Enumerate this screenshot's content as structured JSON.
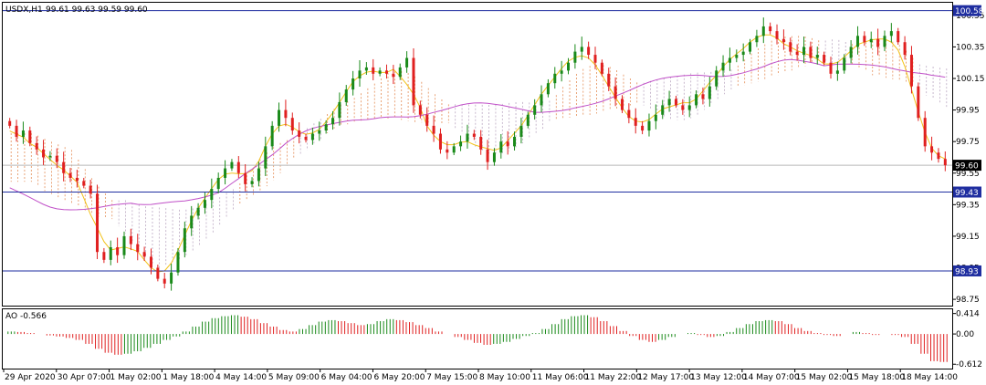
{
  "header": {
    "symbol": "USDX,H1",
    "ohlc": "99.61 99.63 99.59 99.60"
  },
  "indicator": {
    "label": "AO -0.566",
    "ticks": [
      "0.414",
      "0.00",
      "-0.612"
    ],
    "range": [
      -0.7,
      0.5
    ]
  },
  "colors": {
    "bull": "#1a8a1a",
    "bear": "#e02020",
    "level_line": "#1f2ea0",
    "level_badge": "#1f2ea0",
    "current_badge": "#000000",
    "ma_fast": "#f2c21a",
    "ma_slow": "#c050c8",
    "cloud_a": "#e07a3a",
    "cloud_b": "#b09ab8",
    "grid_frame": "#000000"
  },
  "chart_data": {
    "type": "candlestick",
    "title": "USDX,H1",
    "y_ticks": [
      "100.55",
      "100.35",
      "100.15",
      "99.95",
      "99.75",
      "99.55",
      "99.35",
      "99.15",
      "98.95",
      "98.75"
    ],
    "x_ticks": [
      "29 Apr 2020",
      "30 Apr 07:00",
      "1 May 02:00",
      "1 May 18:00",
      "4 May 14:00",
      "5 May 09:00",
      "6 May 04:00",
      "6 May 20:00",
      "7 May 15:00",
      "8 May 10:00",
      "11 May 06:00",
      "11 May 22:00",
      "12 May 17:00",
      "13 May 12:00",
      "14 May 07:00",
      "15 May 02:00",
      "15 May 18:00",
      "18 May 14:00"
    ],
    "ylim": [
      98.71,
      100.63
    ],
    "levels": [
      {
        "label": "100.58",
        "value": 100.58
      },
      {
        "label": "99.43",
        "value": 99.43
      },
      {
        "label": "98.93",
        "value": 98.93
      }
    ],
    "current": {
      "label": "99.60",
      "value": 99.6
    },
    "series_close": [
      99.85,
      99.78,
      99.82,
      99.74,
      99.7,
      99.65,
      99.66,
      99.62,
      99.55,
      99.52,
      99.5,
      99.47,
      99.42,
      99.05,
      99.0,
      99.08,
      99.03,
      99.15,
      99.1,
      99.05,
      99.02,
      98.95,
      98.88,
      98.85,
      98.92,
      99.05,
      99.2,
      99.28,
      99.33,
      99.38,
      99.45,
      99.52,
      99.58,
      99.62,
      99.55,
      99.48,
      99.5,
      99.58,
      99.72,
      99.85,
      99.95,
      99.9,
      99.82,
      99.78,
      99.76,
      99.8,
      99.82,
      99.86,
      99.9,
      100.0,
      100.08,
      100.15,
      100.2,
      100.22,
      100.18,
      100.2,
      100.18,
      100.16,
      100.22,
      100.28,
      99.98,
      99.92,
      99.85,
      99.8,
      99.7,
      99.68,
      99.72,
      99.75,
      99.8,
      99.78,
      99.7,
      99.62,
      99.68,
      99.75,
      99.72,
      99.78,
      99.85,
      99.92,
      99.98,
      100.05,
      100.12,
      100.18,
      100.2,
      100.25,
      100.32,
      100.35,
      100.3,
      100.25,
      100.18,
      100.1,
      100.02,
      99.95,
      99.9,
      99.85,
      99.82,
      99.88,
      99.92,
      99.98,
      100.02,
      99.98,
      99.95,
      99.98,
      100.05,
      100.02,
      100.1,
      100.2,
      100.25,
      100.28,
      100.3,
      100.32,
      100.38,
      100.42,
      100.48,
      100.45,
      100.4,
      100.38,
      100.32,
      100.3,
      100.35,
      100.28,
      100.3,
      100.25,
      100.18,
      100.2,
      100.28,
      100.35,
      100.42,
      100.38,
      100.4,
      100.35,
      100.42,
      100.45,
      100.38,
      100.3,
      100.1,
      99.9,
      99.72,
      99.68,
      99.64,
      99.6
    ],
    "ao": [
      0.05,
      0.04,
      0.02,
      0.0,
      -0.03,
      -0.05,
      -0.08,
      -0.12,
      -0.2,
      -0.3,
      -0.38,
      -0.42,
      -0.4,
      -0.35,
      -0.28,
      -0.2,
      -0.12,
      -0.05,
      0.05,
      0.15,
      0.25,
      0.32,
      0.36,
      0.38,
      0.35,
      0.3,
      0.22,
      0.15,
      0.08,
      0.05,
      0.1,
      0.18,
      0.25,
      0.28,
      0.26,
      0.22,
      0.18,
      0.2,
      0.26,
      0.3,
      0.28,
      0.24,
      0.18,
      0.12,
      0.05,
      0.0,
      -0.06,
      -0.12,
      -0.18,
      -0.22,
      -0.2,
      -0.16,
      -0.1,
      -0.04,
      0.02,
      0.1,
      0.2,
      0.3,
      0.36,
      0.38,
      0.34,
      0.26,
      0.16,
      0.06,
      -0.04,
      -0.12,
      -0.16,
      -0.12,
      -0.06,
      0.0,
      0.02,
      -0.02,
      -0.06,
      -0.04,
      0.04,
      0.12,
      0.2,
      0.26,
      0.28,
      0.26,
      0.2,
      0.12,
      0.06,
      0.02,
      -0.02,
      -0.04,
      0.0,
      0.04,
      0.02,
      -0.02,
      0.0,
      -0.02,
      -0.06,
      -0.2,
      -0.4,
      -0.55,
      -0.566
    ]
  }
}
